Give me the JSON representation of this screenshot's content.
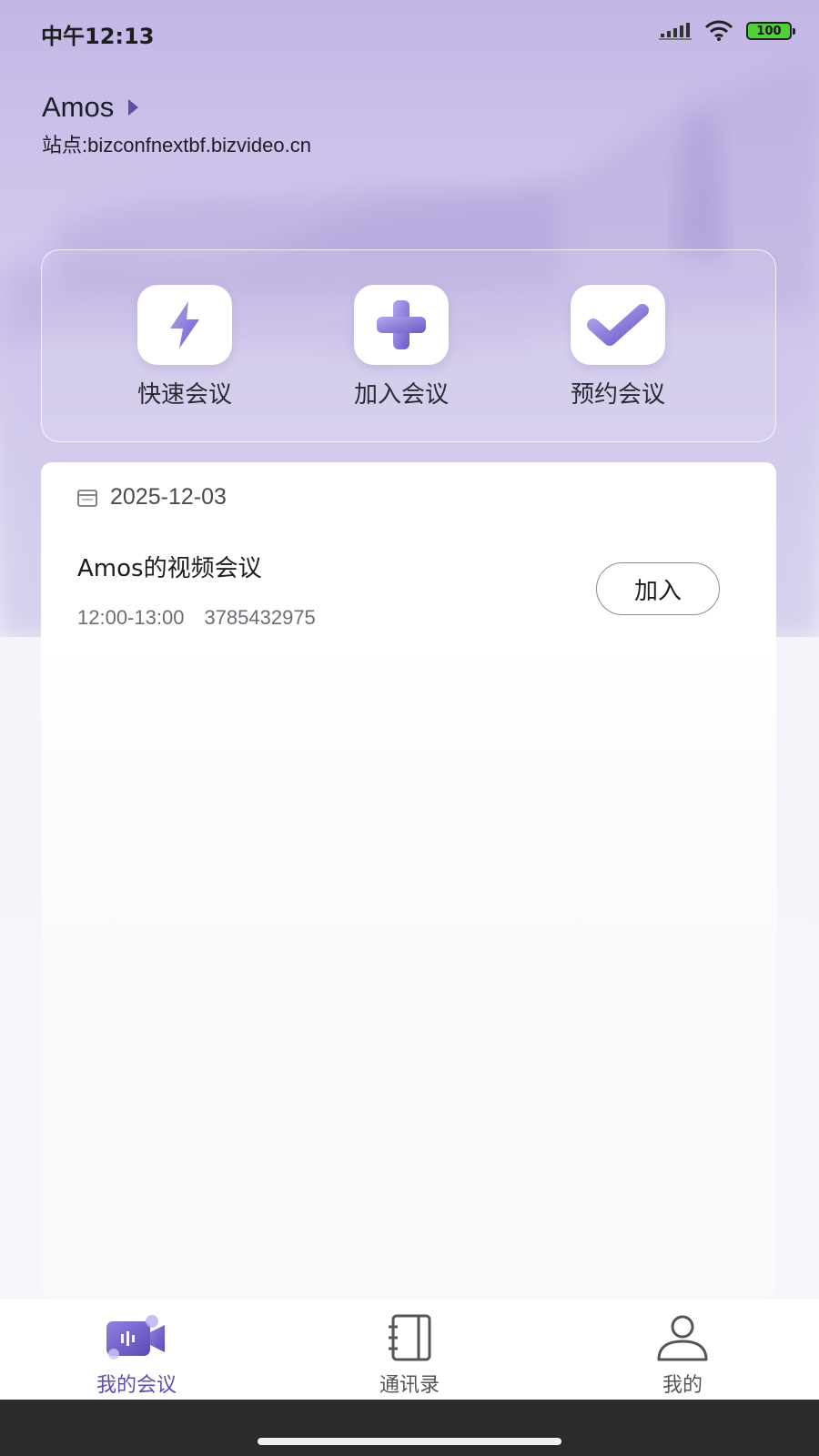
{
  "status_bar": {
    "time": "中午12:13",
    "battery": "100"
  },
  "header": {
    "user_name": "Amos",
    "site": "站点:bizconfnextbf.bizvideo.cn"
  },
  "quick_actions": [
    {
      "label": "快速会议",
      "icon": "lightning-icon"
    },
    {
      "label": "加入会议",
      "icon": "plus-icon"
    },
    {
      "label": "预约会议",
      "icon": "checkmark-icon"
    }
  ],
  "meeting_list": {
    "date": "2025-12-03",
    "items": [
      {
        "title": "Amos的视频会议",
        "time": "12:00-13:00",
        "meeting_id": "3785432975",
        "join_label": "加入"
      }
    ]
  },
  "tab_bar": {
    "tabs": [
      {
        "label": "我的会议",
        "icon": "video-camera-icon",
        "active": true
      },
      {
        "label": "通讯录",
        "icon": "address-book-icon",
        "active": false
      },
      {
        "label": "我的",
        "icon": "person-icon",
        "active": false
      }
    ]
  },
  "colors": {
    "accent": "#5b4fb2",
    "header_gradient_top": "#c2b6e6",
    "battery_fill": "#4fcf3a"
  }
}
